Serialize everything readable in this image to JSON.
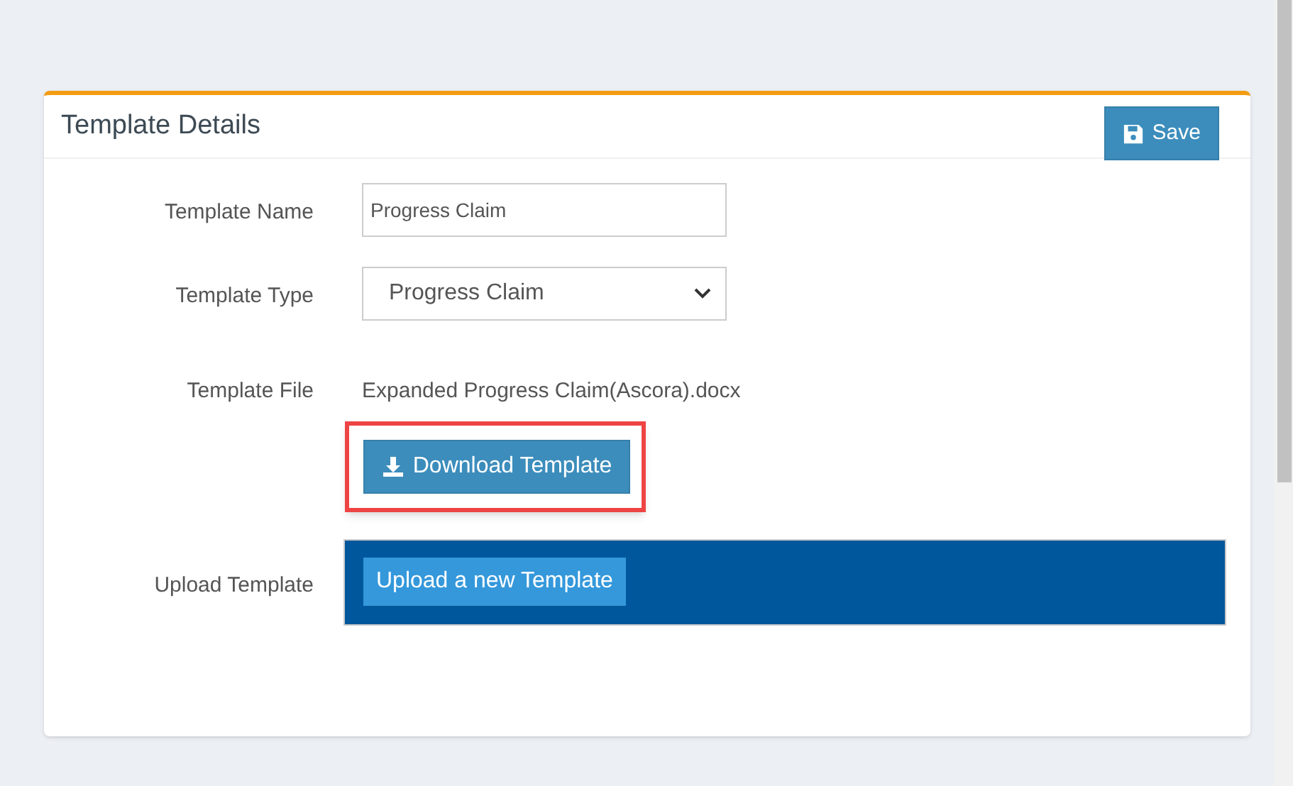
{
  "card": {
    "title": "Template Details",
    "save_button": "Save"
  },
  "form": {
    "template_name": {
      "label": "Template Name",
      "value": "Progress Claim"
    },
    "template_type": {
      "label": "Template Type",
      "value": "Progress Claim"
    },
    "template_file": {
      "label": "Template File",
      "file_name": "Expanded Progress Claim(Ascora).docx",
      "download_button": "Download Template",
      "highlighted": true
    },
    "upload_template": {
      "label": "Upload Template",
      "button": "Upload a new Template"
    }
  }
}
